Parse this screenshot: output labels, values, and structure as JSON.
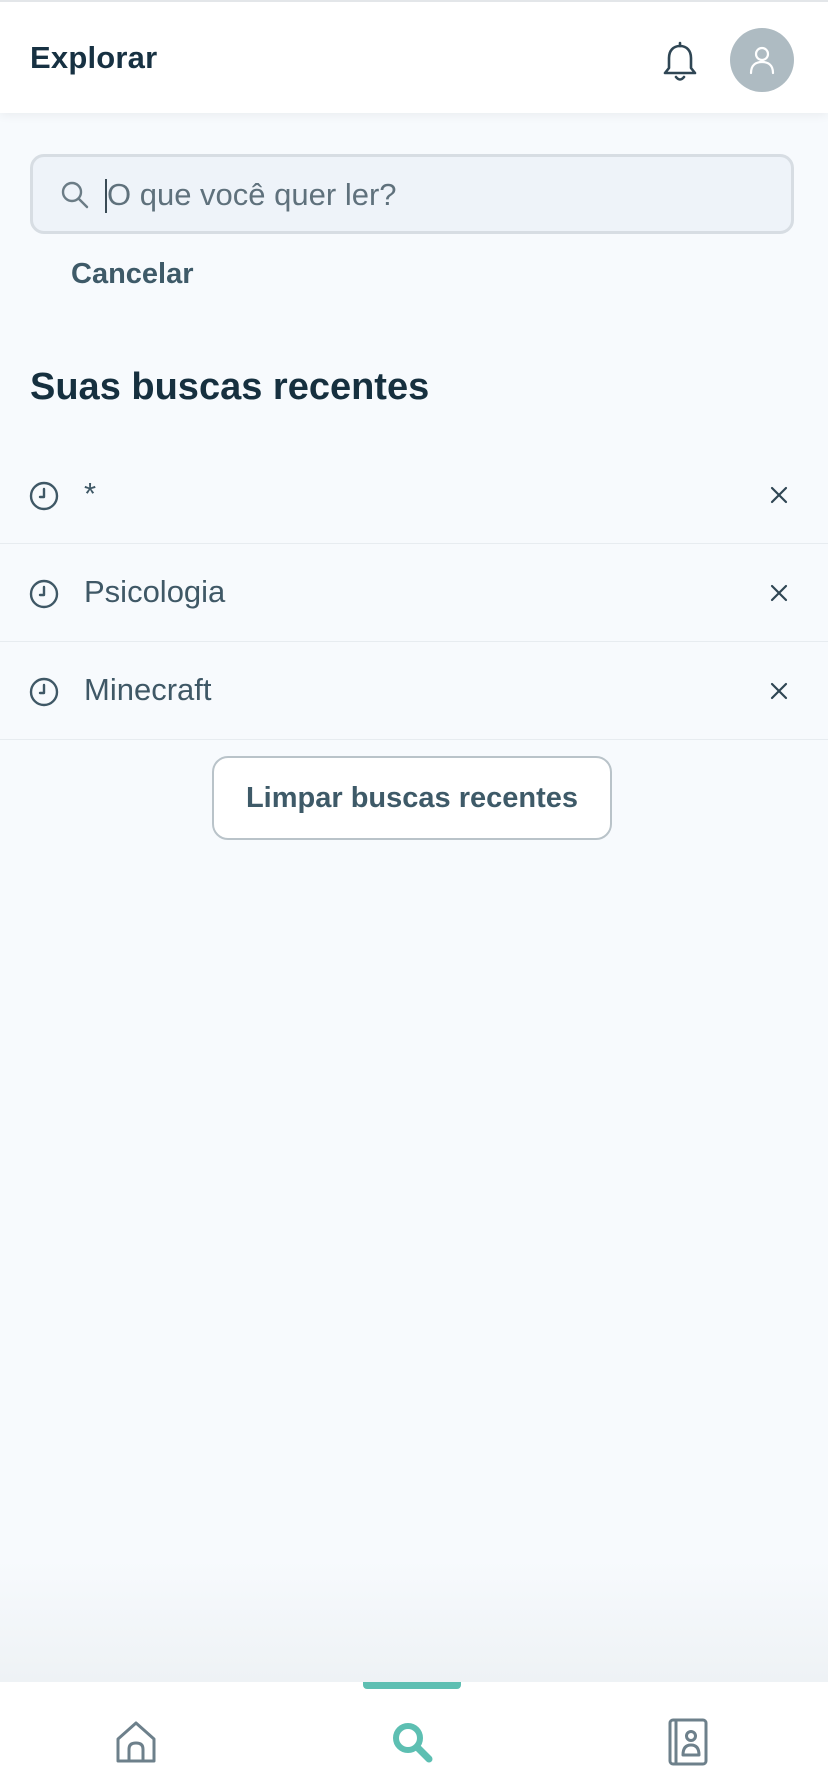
{
  "header": {
    "title": "Explorar",
    "bell_icon": "bell-icon",
    "avatar_icon": "user-icon"
  },
  "search": {
    "placeholder": "O que você quer ler?",
    "value": "",
    "cancel_label": "Cancelar"
  },
  "recent": {
    "title": "Suas buscas recentes",
    "items": [
      {
        "label": "*"
      },
      {
        "label": "Psicologia"
      },
      {
        "label": "Minecraft"
      }
    ],
    "clear_label": "Limpar buscas recentes"
  },
  "nav": {
    "items": [
      {
        "icon": "home-icon"
      },
      {
        "icon": "search-icon",
        "active": true
      },
      {
        "icon": "library-icon"
      }
    ],
    "active_color": "#5dbfb2"
  },
  "colors": {
    "background": "#f7fafd",
    "text_dark": "#16303f",
    "text_muted": "#3f5866",
    "accent": "#5dbfb2"
  }
}
